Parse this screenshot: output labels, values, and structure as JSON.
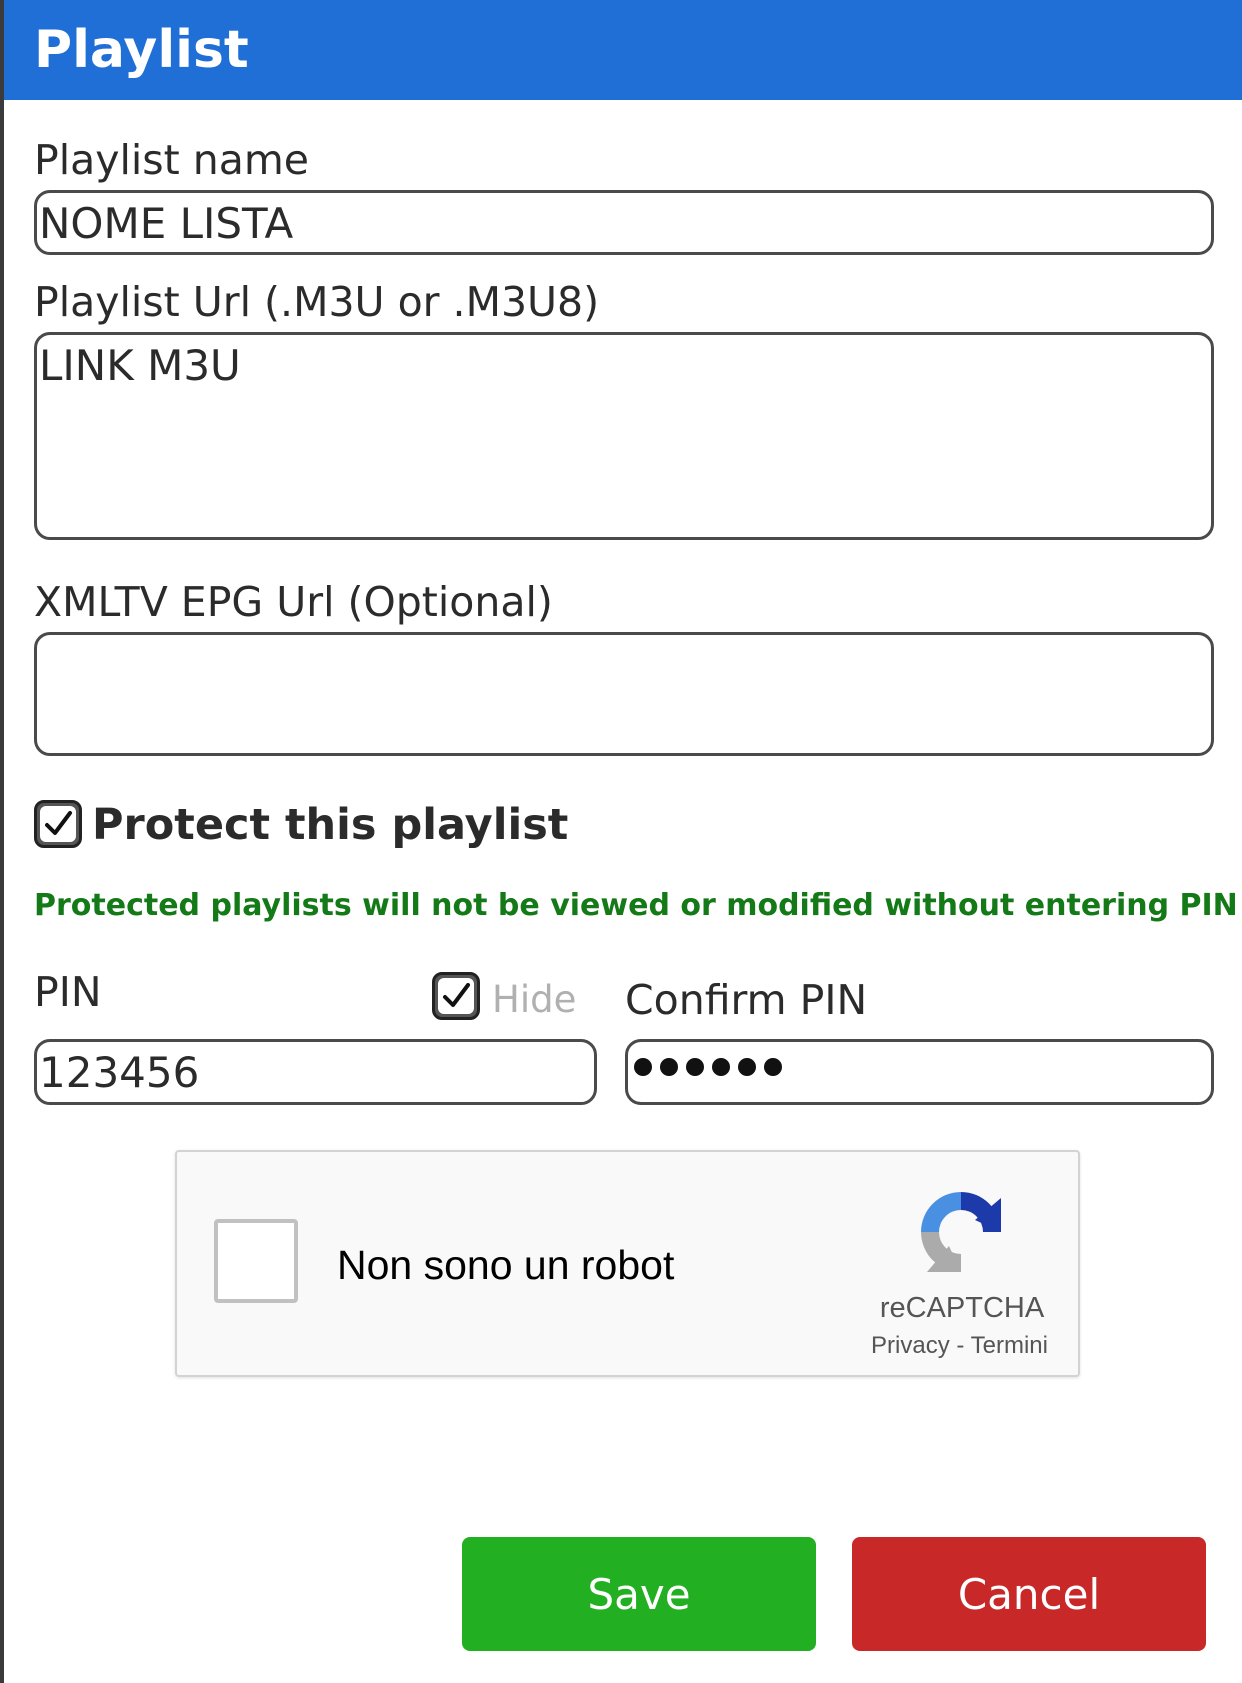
{
  "header": {
    "title": "Playlist"
  },
  "form": {
    "name_label": "Playlist name",
    "name_value": "NOME LISTA",
    "url_label": "Playlist Url (.M3U or .M3U8)",
    "url_value": "LINK M3U",
    "epg_label": "XMLTV EPG Url (Optional)",
    "epg_value": "",
    "protect": {
      "label": "Protect this playlist",
      "checked": true
    },
    "notice": "Protected playlists will not be viewed or modified without entering PIN",
    "pin_label": "PIN",
    "pin_value": "123456",
    "hide": {
      "label": "Hide",
      "checked": true
    },
    "confirm_pin_label": "Confirm PIN",
    "confirm_pin_masked_length": 6
  },
  "captcha": {
    "text": "Non sono un robot",
    "brand": "reCAPTCHA",
    "privacy": "Privacy",
    "separator": "-",
    "terms": "Termini"
  },
  "buttons": {
    "save": "Save",
    "cancel": "Cancel"
  },
  "colors": {
    "header": "#1f6fd6",
    "notice": "#137a17",
    "save": "#22b022",
    "cancel": "#c82828"
  }
}
